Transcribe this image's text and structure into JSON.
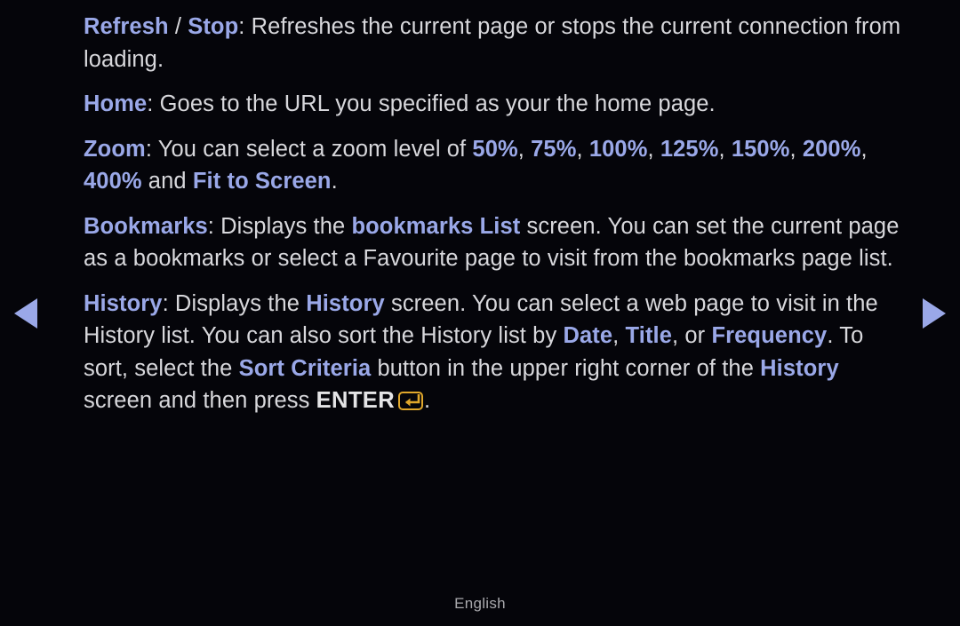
{
  "screen": {
    "background_color": "#05050a",
    "body_text_color": "#d8d8dc",
    "accent_color": "#9aa8e8",
    "key_icon_color": "#e0a72b",
    "language": "English"
  },
  "nav": {
    "prev_label": "◀",
    "next_label": "▶"
  },
  "paragraphs": [
    {
      "id": "refresh-stop",
      "runs": [
        {
          "text": "Refresh",
          "style": "accent"
        },
        {
          "text": " / ",
          "style": "body"
        },
        {
          "text": "Stop",
          "style": "accent"
        },
        {
          "text": ": Refreshes the current page or stops the current connection from loading.",
          "style": "body"
        }
      ]
    },
    {
      "id": "home",
      "runs": [
        {
          "text": "Home",
          "style": "accent"
        },
        {
          "text": ": Goes to the URL you specified as your the home page.",
          "style": "body"
        }
      ]
    },
    {
      "id": "zoom",
      "runs": [
        {
          "text": "Zoom",
          "style": "accent"
        },
        {
          "text": ": You can select a zoom level of ",
          "style": "body"
        },
        {
          "text": "50%",
          "style": "accent"
        },
        {
          "text": ", ",
          "style": "body"
        },
        {
          "text": "75%",
          "style": "accent"
        },
        {
          "text": ", ",
          "style": "body"
        },
        {
          "text": "100%",
          "style": "accent"
        },
        {
          "text": ", ",
          "style": "body"
        },
        {
          "text": "125%",
          "style": "accent"
        },
        {
          "text": ", ",
          "style": "body"
        },
        {
          "text": "150%",
          "style": "accent"
        },
        {
          "text": ", ",
          "style": "body"
        },
        {
          "text": "200%",
          "style": "accent"
        },
        {
          "text": ", ",
          "style": "body"
        },
        {
          "text": "400%",
          "style": "accent"
        },
        {
          "text": " and ",
          "style": "body"
        },
        {
          "text": "Fit to Screen",
          "style": "accent"
        },
        {
          "text": ".",
          "style": "body"
        }
      ]
    },
    {
      "id": "bookmarks",
      "runs": [
        {
          "text": "Bookmarks",
          "style": "accent"
        },
        {
          "text": ": Displays the ",
          "style": "body"
        },
        {
          "text": "bookmarks List",
          "style": "accent"
        },
        {
          "text": " screen. You can set the current page as a bookmarks or select a Favourite page to visit from the bookmarks page list.",
          "style": "body"
        }
      ]
    },
    {
      "id": "history",
      "runs": [
        {
          "text": "History",
          "style": "accent"
        },
        {
          "text": ": Displays the ",
          "style": "body"
        },
        {
          "text": "History",
          "style": "accent"
        },
        {
          "text": " screen. You can select a web page to visit in the History list. You can also sort the History list by ",
          "style": "body"
        },
        {
          "text": "Date",
          "style": "accent"
        },
        {
          "text": ", ",
          "style": "body"
        },
        {
          "text": "Title",
          "style": "accent"
        },
        {
          "text": ", or ",
          "style": "body"
        },
        {
          "text": "Frequency",
          "style": "accent"
        },
        {
          "text": ". To sort, select the ",
          "style": "body"
        },
        {
          "text": "Sort Criteria",
          "style": "accent"
        },
        {
          "text": " button in the upper right corner of the ",
          "style": "body"
        },
        {
          "text": "History",
          "style": "accent"
        },
        {
          "text": " screen and then press ",
          "style": "body"
        },
        {
          "text": "ENTER",
          "style": "bold-white"
        },
        {
          "text": "enter-key-icon",
          "style": "key-icon"
        },
        {
          "text": ".",
          "style": "body"
        }
      ]
    }
  ],
  "footer": {
    "language_label": "English"
  }
}
